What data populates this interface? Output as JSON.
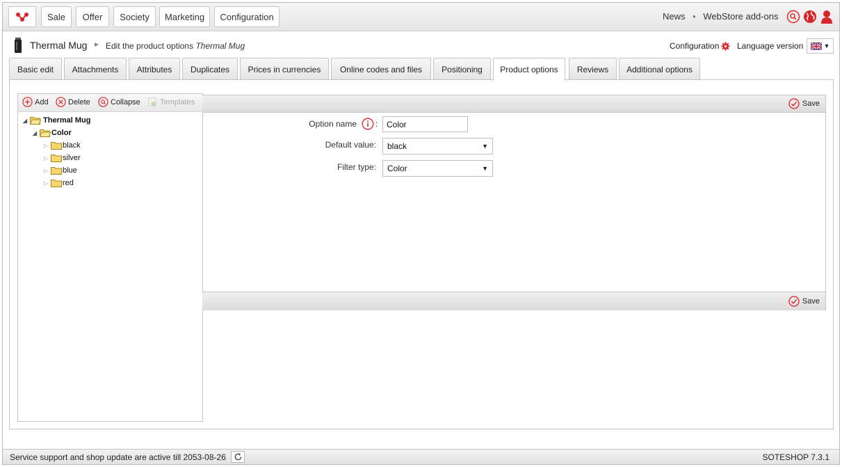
{
  "topbar": {
    "logo_icon": "soteshop-logo-icon",
    "menu": [
      {
        "label": "Sale"
      },
      {
        "label": "Offer"
      },
      {
        "label": "Society"
      },
      {
        "label": "Marketing"
      },
      {
        "label": "Configuration"
      }
    ],
    "links": {
      "news": "News",
      "separator": "•",
      "addons": "WebStore add-ons"
    },
    "icons": [
      "search-icon",
      "globe-icon",
      "user-icon"
    ]
  },
  "title": {
    "product": "Thermal Mug",
    "separator": "►",
    "subtitle_prefix": "Edit the product options",
    "subtitle_product": "Thermal Mug",
    "configuration_label": "Configuration",
    "language_label": "Language version",
    "language_flag": "uk-flag-icon"
  },
  "tabs": [
    {
      "label": "Basic edit"
    },
    {
      "label": "Attachments"
    },
    {
      "label": "Attributes"
    },
    {
      "label": "Duplicates"
    },
    {
      "label": "Prices in currencies"
    },
    {
      "label": "Online codes and files"
    },
    {
      "label": "Positioning"
    },
    {
      "label": "Product options",
      "active": true
    },
    {
      "label": "Reviews"
    },
    {
      "label": "Additional options"
    }
  ],
  "tree_toolbar": {
    "add": "Add",
    "delete": "Delete",
    "collapse": "Collapse",
    "templates": "Templates"
  },
  "tree": {
    "root": "Thermal Mug",
    "group": "Color",
    "items": [
      "black",
      "silver",
      "blue",
      "red"
    ]
  },
  "form": {
    "save_label": "Save",
    "option_name_label": "Option name",
    "option_name_suffix": ":",
    "option_name_value": "Color",
    "default_value_label": "Default value:",
    "default_value_selected": "black",
    "filter_type_label": "Filter type:",
    "filter_type_selected": "Color"
  },
  "status": {
    "text": "Service support and shop update are active till 2053-08-26",
    "version": "SOTESHOP 7.3.1"
  },
  "colors": {
    "accent": "#d9262b",
    "folder": "#f5d76e"
  }
}
